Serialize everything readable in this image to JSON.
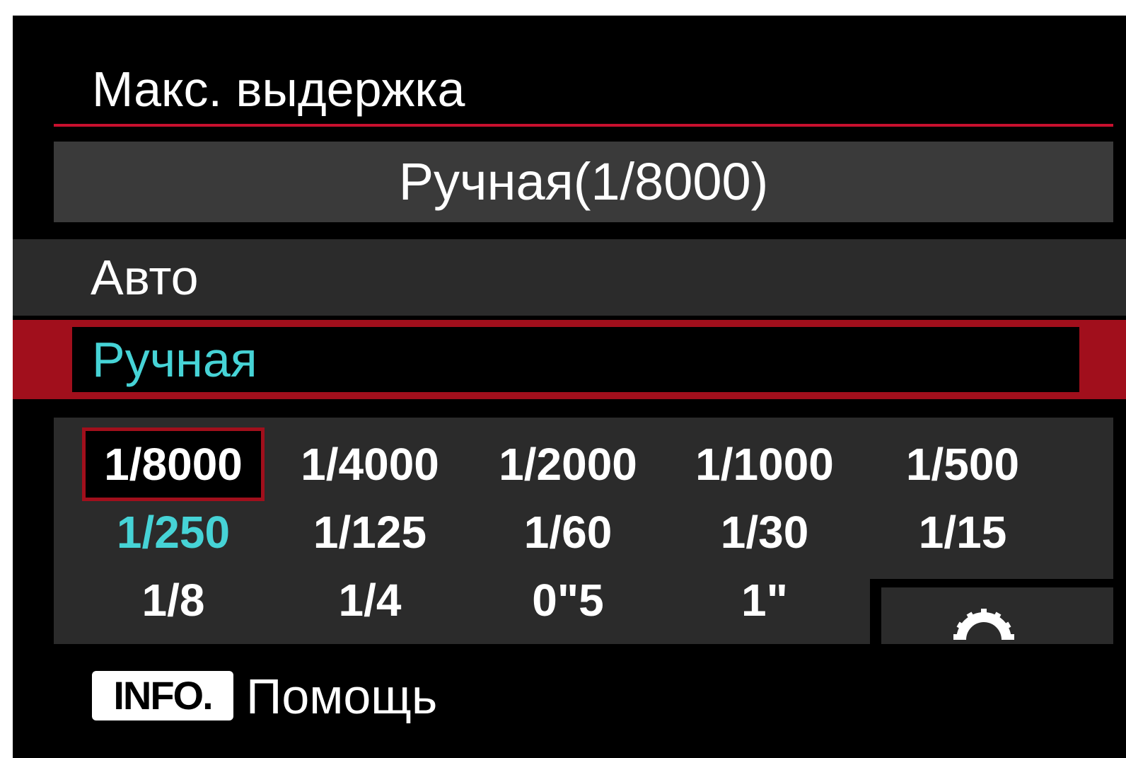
{
  "header": {
    "title": "Макс. выдержка",
    "current_value": "Ручная(1/8000)"
  },
  "options": {
    "auto_label": "Авто",
    "manual_label": "Ручная",
    "selected": "manual"
  },
  "shutter_speeds": {
    "values": [
      "1/8000",
      "1/4000",
      "1/2000",
      "1/1000",
      "1/500",
      "1/250",
      "1/125",
      "1/60",
      "1/30",
      "1/15",
      "1/8",
      "1/4",
      "0\"5",
      "1\""
    ],
    "cursor_value": "1/8000",
    "highlighted_value": "1/250"
  },
  "footer": {
    "info_button_label": "INFO.",
    "help_label": "Помощь",
    "dial_icon": "main-dial-icon"
  },
  "colors": {
    "accent_red": "#c8102e",
    "selection_red": "#a10f1c",
    "highlight_cyan": "#46d3d6",
    "panel_gray": "#2b2b2b"
  }
}
